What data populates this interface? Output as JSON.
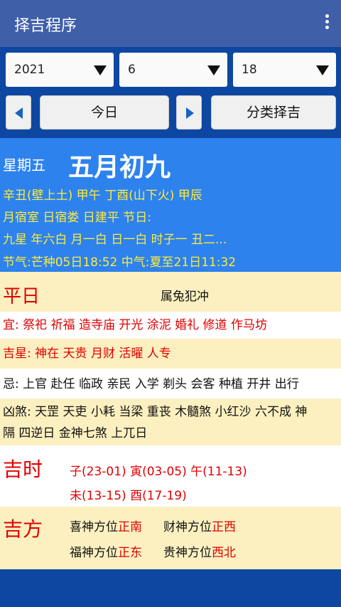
{
  "appbar": {
    "title": "择吉程序",
    "menu_icon": "more-vert-icon"
  },
  "toolbar": {
    "year": "2021",
    "month": "6",
    "day": "18",
    "today_label": "今日",
    "category_label": "分类择吉"
  },
  "info": {
    "weekday": "星期五",
    "lunar_date": "五月初九",
    "ganzhi": "辛丑(壁上土) 甲午 丁酉(山下火) 甲辰",
    "mansion": "月宿室 日宿娄 日建平  节日:",
    "nine_star": "九星    年六白 月一白 日一白 时子一 丑二...",
    "solar_terms": "节气:芒种05日18:52 中气:夏至21日11:32"
  },
  "details": {
    "day_officer": "平日",
    "clash": "属兔犯冲",
    "suitable": "宜: 祭祀 祈福 造寺庙 开光 涂泥 婚礼 修道 作马坊",
    "lucky_stars": "吉星: 神在 天贵 月财 活曜 人专",
    "avoid": "忌: 上官 赴任 临政 亲民 入学 剃头 会客 种植 开井 出行",
    "evil_line1": "凶煞: 天罡 天吏 小耗 当梁 重丧 木髓煞 小红沙 六不成 神",
    "evil_line2": "隔 四逆日 金神七煞 上兀日",
    "lucky_hours_label": "吉时",
    "lucky_hours_line1": "子(23-01) 寅(03-05) 午(11-13)",
    "lucky_hours_line2": "未(13-15) 酉(17-19)",
    "lucky_dir_label": "吉方",
    "directions": {
      "joy_key": "喜神方位",
      "joy_val": "正南",
      "wealth_key": "财神方位",
      "wealth_val": "正西",
      "fortune_key": "福神方位",
      "fortune_val": "正东",
      "noble_key": "贵神方位",
      "noble_val": "西北"
    }
  },
  "colors": {
    "appbar": "#3f5fa9",
    "toolbar": "#0d47a1",
    "info_bg": "#2d82ee",
    "highlight_yellow": "#ffeb3b",
    "row_yellow": "#fdf0c0",
    "red_text": "#e00000"
  }
}
